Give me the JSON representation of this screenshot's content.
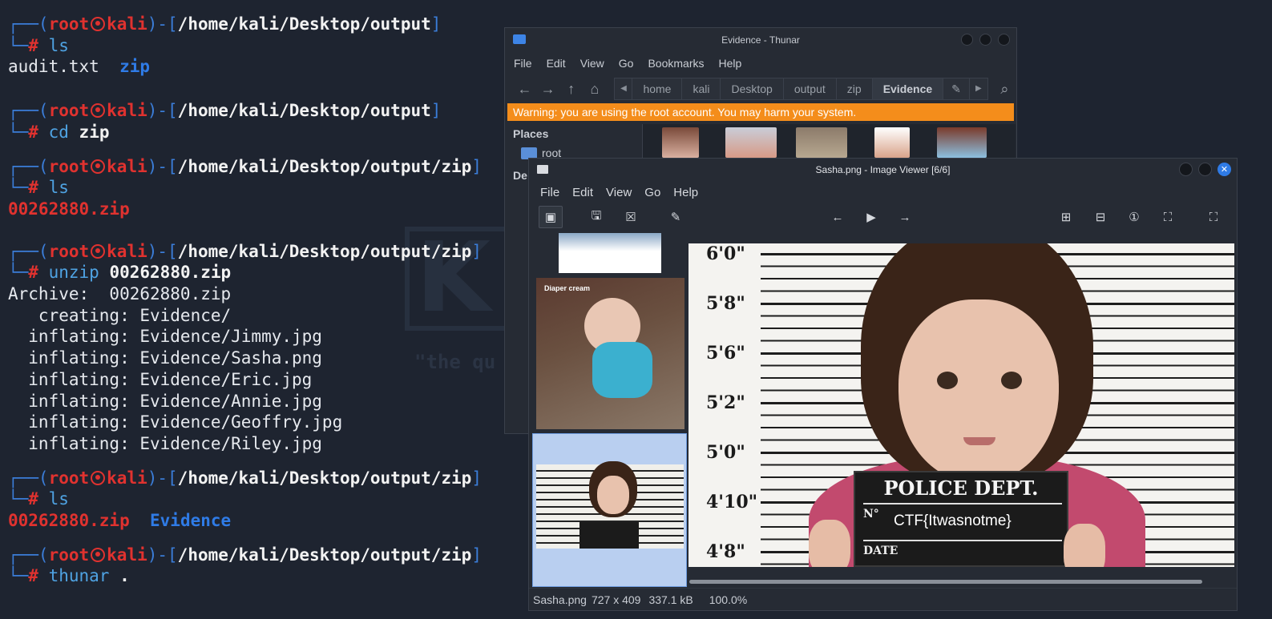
{
  "terminal": {
    "user": "root",
    "host": "kali",
    "blocks": [
      {
        "path": "/home/kali/Desktop/output",
        "cmd": "ls",
        "arg": "",
        "outputs": [
          [
            {
              "t": "audit.txt  ",
              "c": "out"
            },
            {
              "t": "zip",
              "c": "dir"
            }
          ]
        ]
      },
      {
        "path": "/home/kali/Desktop/output",
        "cmd": "cd",
        "arg": "zip",
        "outputs": []
      },
      {
        "path": "/home/kali/Desktop/output/zip",
        "cmd": "ls",
        "arg": "",
        "outputs": [
          [
            {
              "t": "00262880.zip",
              "c": "zipf"
            }
          ]
        ]
      },
      {
        "path": "/home/kali/Desktop/output/zip",
        "cmd": "unzip",
        "arg": "00262880.zip",
        "outputs": [
          [
            {
              "t": "Archive:  00262880.zip",
              "c": "out"
            }
          ],
          [
            {
              "t": "   creating: Evidence/",
              "c": "out"
            }
          ],
          [
            {
              "t": "  inflating: Evidence/Jimmy.jpg",
              "c": "out"
            }
          ],
          [
            {
              "t": "  inflating: Evidence/Sasha.png",
              "c": "out"
            }
          ],
          [
            {
              "t": "  inflating: Evidence/Eric.jpg",
              "c": "out"
            }
          ],
          [
            {
              "t": "  inflating: Evidence/Annie.jpg",
              "c": "out"
            }
          ],
          [
            {
              "t": "  inflating: Evidence/Geoffry.jpg",
              "c": "out"
            }
          ],
          [
            {
              "t": "  inflating: Evidence/Riley.jpg",
              "c": "out"
            }
          ]
        ]
      },
      {
        "path": "/home/kali/Desktop/output/zip",
        "cmd": "ls",
        "arg": "",
        "outputs": [
          [
            {
              "t": "00262880.zip",
              "c": "zipf"
            },
            {
              "t": "  ",
              "c": "out"
            },
            {
              "t": "Evidence",
              "c": "dir"
            }
          ]
        ]
      },
      {
        "path": "/home/kali/Desktop/output/zip",
        "cmd": "thunar",
        "arg": ".",
        "outputs": []
      }
    ],
    "watermark_quote": "\"the qu"
  },
  "thunar": {
    "title": "Evidence - Thunar",
    "menu": [
      "File",
      "Edit",
      "View",
      "Go",
      "Bookmarks",
      "Help"
    ],
    "breadcrumbs": [
      "home",
      "kali",
      "Desktop",
      "output",
      "zip",
      "Evidence"
    ],
    "warning": "Warning: you are using the root account. You may harm your system.",
    "places_title": "Places",
    "places_root": "root",
    "places_de": "De"
  },
  "viewer": {
    "title": "Sasha.png - Image Viewer [6/6]",
    "menu": [
      "File",
      "Edit",
      "View",
      "Go",
      "Help"
    ],
    "status_file": "Sasha.png",
    "status_dims": "727 x 409",
    "status_size": "337.1 kB",
    "status_zoom": "100.0%",
    "thumb_caption": "Diaper cream",
    "image": {
      "heights": [
        "6'0\"",
        "5'8\"",
        "5'6\"",
        "5'2\"",
        "5'0\"",
        "4'10\"",
        "4'8\""
      ],
      "sign_title": "POLICE DEPT.",
      "sign_no": "N°",
      "sign_flag": "CTF{Itwasnotme}",
      "sign_date": "DATE"
    }
  },
  "colors": {
    "terminal_bg": "#1e2430",
    "warning": "#f48d1b",
    "accent_blue": "#2f7be6",
    "prompt_red": "#e0322f"
  }
}
